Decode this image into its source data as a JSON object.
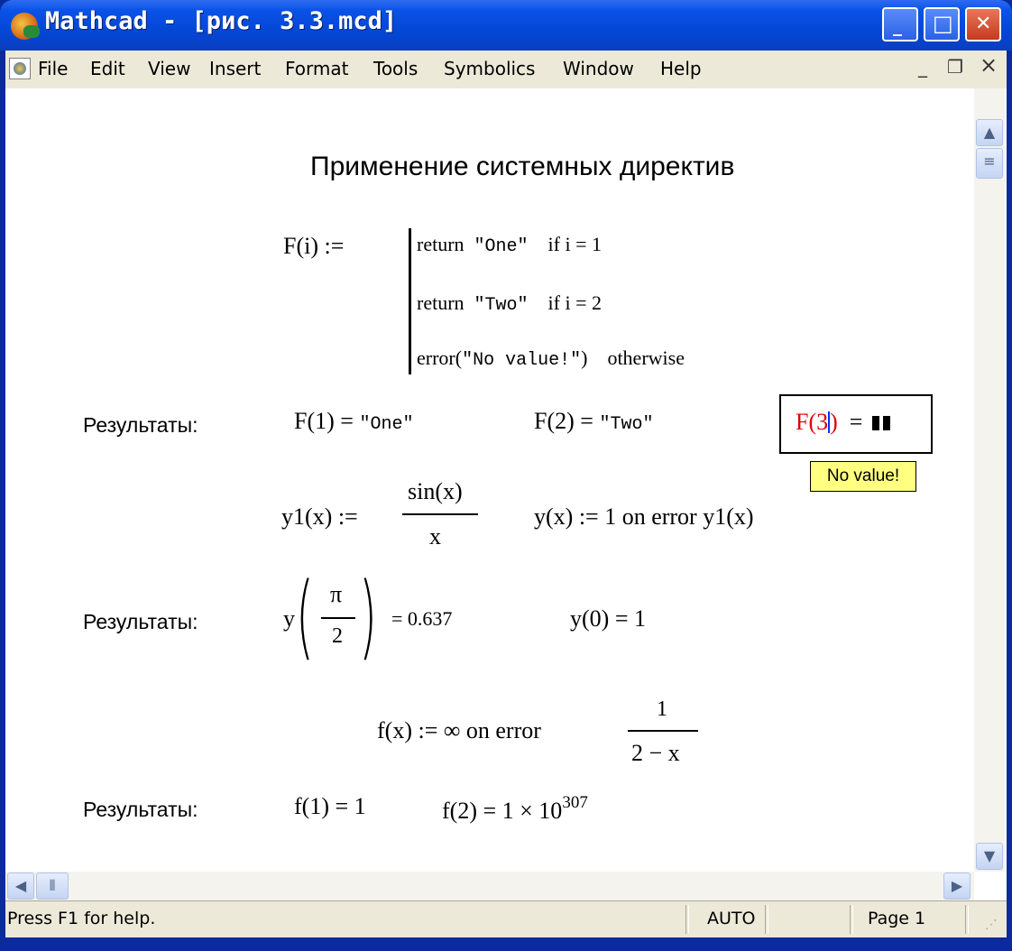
{
  "window": {
    "title": "Mathcad - [рис. 3.3.mcd]",
    "controls": {
      "minimize": "_",
      "maximize": "□",
      "close": "✕"
    }
  },
  "menubar": {
    "items": [
      {
        "label": "File"
      },
      {
        "label": "Edit"
      },
      {
        "label": "View"
      },
      {
        "label": "Insert"
      },
      {
        "label": "Format"
      },
      {
        "label": "Tools"
      },
      {
        "label": "Symbolics"
      },
      {
        "label": "Window"
      },
      {
        "label": "Help"
      }
    ],
    "doc_controls": {
      "minimize": "_",
      "restore": "❐",
      "close": "×"
    }
  },
  "worksheet": {
    "heading": "Применение системных директив",
    "program": {
      "def": "F(i) :=",
      "lines": [
        {
          "stmt": "return",
          "value": "\"One\"",
          "cond": "if  i = 1"
        },
        {
          "stmt": "return",
          "value": "\"Two\"",
          "cond": "if  i = 2"
        },
        {
          "stmt": "error(",
          "value": "\"No value!\"",
          "stmt_end": ")",
          "cond": "otherwise"
        }
      ]
    },
    "results1": {
      "label": "Результаты:",
      "eq1_lhs": "F(1) =",
      "eq1_rhs": "\"One\"",
      "eq2_lhs": "F(2) =",
      "eq2_rhs": "\"Two\"",
      "err_expr": "F(3",
      "err_close": ")",
      "err_eq": "=",
      "tooltip": "No value!"
    },
    "def2": {
      "y1_lhs": "y1(x) :=",
      "y1_num": "sin(x)",
      "y1_den": "x",
      "y_def": "y(x) := 1   on error y1(x)"
    },
    "results2": {
      "label": "Результаты:",
      "y_fn": "y",
      "pi": "π",
      "two": "2",
      "y_val": "= 0.637",
      "y0": "y(0) = 1"
    },
    "def3": {
      "f_lhs": "f(x) := ∞   on error",
      "num": "1",
      "den": "2 − x"
    },
    "results3": {
      "label": "Результаты:",
      "f1": "f(1) = 1",
      "f2": "f(2) = 1 × 10",
      "f2_exp": "307"
    }
  },
  "statusbar": {
    "help": "Press F1 for help.",
    "mode": "AUTO",
    "page": "Page 1"
  }
}
